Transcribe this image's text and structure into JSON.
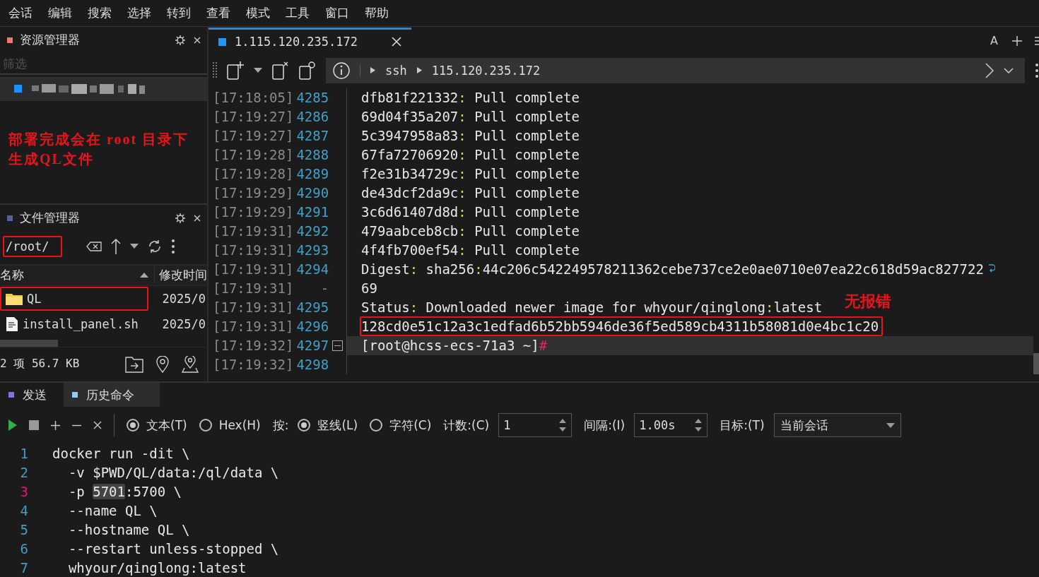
{
  "menu": [
    "会话",
    "编辑",
    "搜索",
    "选择",
    "转到",
    "查看",
    "模式",
    "工具",
    "窗口",
    "帮助"
  ],
  "explorer": {
    "title": "资源管理器",
    "filter": {
      "placeholder": "筛选"
    },
    "sessions": [
      {
        "selected": true
      }
    ]
  },
  "note_left": {
    "lines": [
      "部署完成会在 root 目录下",
      "生成QL文件"
    ]
  },
  "file_manager": {
    "title": "文件管理器",
    "path": {
      "value": "/root/",
      "highlighted": true
    },
    "columns": [
      "名称",
      "修改时间"
    ],
    "files": [
      {
        "kind": "folder",
        "name": "QL",
        "modified": "2025/0",
        "highlighted": true
      },
      {
        "kind": "script",
        "name": "install_panel.sh",
        "modified": "2025/0",
        "highlighted": false
      }
    ],
    "status": "2 项 56.7 KB"
  },
  "terminal": {
    "tab": {
      "title": "1.115.120.235.172",
      "selected": true
    },
    "font_button": "A",
    "breadcrumb": [
      "ssh",
      "115.120.235.172"
    ],
    "lines": [
      {
        "time": "[17:18:05]",
        "num": "4285",
        "segments": [
          {
            "text": "dfb81f221332"
          },
          {
            "text": ":",
            "kind": "sep"
          },
          {
            "text": " Pull complete"
          }
        ]
      },
      {
        "time": "[17:19:27]",
        "num": "4286",
        "segments": [
          {
            "text": "69d04f35a207"
          },
          {
            "text": ":",
            "kind": "sep"
          },
          {
            "text": " Pull complete"
          }
        ]
      },
      {
        "time": "[17:19:27]",
        "num": "4287",
        "segments": [
          {
            "text": "5c3947958a83"
          },
          {
            "text": ":",
            "kind": "sep"
          },
          {
            "text": " Pull complete"
          }
        ]
      },
      {
        "time": "[17:19:28]",
        "num": "4288",
        "segments": [
          {
            "text": "67fa72706920"
          },
          {
            "text": ":",
            "kind": "sep"
          },
          {
            "text": " Pull complete"
          }
        ]
      },
      {
        "time": "[17:19:28]",
        "num": "4289",
        "segments": [
          {
            "text": "f2e31b34729c"
          },
          {
            "text": ":",
            "kind": "sep"
          },
          {
            "text": " Pull complete"
          }
        ]
      },
      {
        "time": "[17:19:29]",
        "num": "4290",
        "segments": [
          {
            "text": "de43dcf2da9c"
          },
          {
            "text": ":",
            "kind": "sep"
          },
          {
            "text": " Pull complete"
          }
        ]
      },
      {
        "time": "[17:19:29]",
        "num": "4291",
        "segments": [
          {
            "text": "3c6d61407d8d"
          },
          {
            "text": ":",
            "kind": "sep"
          },
          {
            "text": " Pull complete"
          }
        ]
      },
      {
        "time": "[17:19:31]",
        "num": "4292",
        "segments": [
          {
            "text": "479aabceb8cb"
          },
          {
            "text": ":",
            "kind": "sep"
          },
          {
            "text": " Pull complete"
          }
        ]
      },
      {
        "time": "[17:19:31]",
        "num": "4293",
        "segments": [
          {
            "text": "4f4fb700ef54"
          },
          {
            "text": ":",
            "kind": "sep"
          },
          {
            "text": " Pull complete"
          }
        ]
      },
      {
        "time": "[17:19:31]",
        "num": "4294",
        "wrapped": true,
        "segments": [
          {
            "text": "Digest"
          },
          {
            "text": ":",
            "kind": "sep"
          },
          {
            "text": " sha256"
          },
          {
            "text": ":",
            "kind": "sep"
          },
          {
            "text": "44c206c542249578211362cebe737ce2e0ae0710e07ea22c618d59ac827722"
          }
        ]
      },
      {
        "time": "[17:19:31]",
        "num": "-",
        "segments": [
          {
            "text": "69"
          }
        ]
      },
      {
        "time": "[17:19:31]",
        "num": "4295",
        "segments": [
          {
            "text": "Status"
          },
          {
            "text": ":",
            "kind": "sep"
          },
          {
            "text": " Downloaded newer image for whyour/qinglong"
          },
          {
            "text": ":",
            "kind": "sep"
          },
          {
            "text": "latest"
          }
        ]
      },
      {
        "time": "[17:19:31]",
        "num": "4296",
        "highlighted": true,
        "segments": [
          {
            "text": "128cd0e51c12a3c1edfad6b52bb5946de36f5ed589cb4311b58081d0e4bc1c20"
          }
        ]
      },
      {
        "time": "[17:19:32]",
        "num": "4297",
        "foldable": true,
        "current": true,
        "segments": [
          {
            "text": "[root@hcss-ecs-71a3 ~]"
          },
          {
            "text": "#",
            "kind": "prompt"
          }
        ]
      },
      {
        "time": "[17:19:32]",
        "num": "4298"
      }
    ],
    "note": "无报错"
  },
  "send_panel": {
    "tabs": [
      {
        "label": "发送",
        "selected": true,
        "color": "#8a6fdc"
      },
      {
        "label": "历史命令",
        "selected": false,
        "color": "#8fd0ee"
      }
    ],
    "options": [
      {
        "kind": "radio",
        "label": "文本(T)",
        "checked": true
      },
      {
        "kind": "radio",
        "label": "Hex(H)",
        "checked": false
      },
      {
        "kind": "label",
        "label": "按:"
      },
      {
        "kind": "radio",
        "label": "竖线(L)",
        "checked": true
      },
      {
        "kind": "radio",
        "label": "字符(C)",
        "checked": false
      }
    ],
    "count": {
      "label": "计数:(C)",
      "value": "1"
    },
    "interval": {
      "label": "间隔:(I)",
      "value": "1.00s"
    },
    "target": {
      "label": "目标:(T)",
      "value": "当前会话"
    }
  },
  "editor": {
    "lines": [
      {
        "num": "1",
        "current": false,
        "segments": [
          {
            "text": "docker run -dit \\"
          }
        ]
      },
      {
        "num": "2",
        "current": false,
        "segments": [
          {
            "text": "  -v $PWD/QL/data:/ql/data \\"
          }
        ]
      },
      {
        "num": "3",
        "current": true,
        "segments": [
          {
            "text": "  -p "
          },
          {
            "text": "5701",
            "highlighted": true
          },
          {
            "text": ":5700 \\"
          }
        ]
      },
      {
        "num": "4",
        "current": false,
        "segments": [
          {
            "text": "  --name QL \\"
          }
        ]
      },
      {
        "num": "5",
        "current": false,
        "segments": [
          {
            "text": "  --hostname QL \\"
          }
        ]
      },
      {
        "num": "6",
        "current": false,
        "segments": [
          {
            "text": "  --restart unless-stopped \\"
          }
        ]
      },
      {
        "num": "7",
        "current": false,
        "segments": [
          {
            "text": "  whyour/qinglong:latest"
          }
        ]
      }
    ]
  }
}
